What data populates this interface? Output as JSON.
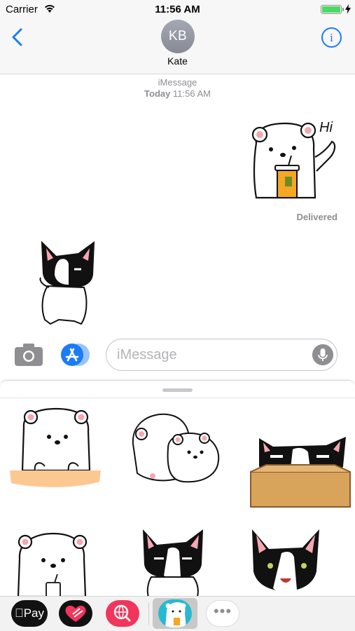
{
  "status_bar": {
    "carrier": "Carrier",
    "time": "11:56 AM"
  },
  "header": {
    "avatar_initials": "KB",
    "contact_name": "Kate"
  },
  "conversation": {
    "service": "iMessage",
    "day": "Today",
    "time": "11:56 AM",
    "sent_sticker_text": "Hi",
    "delivery_status": "Delivered"
  },
  "input": {
    "placeholder": "iMessage"
  },
  "tray": {
    "apple_pay_label": "Pay"
  },
  "colors": {
    "accent": "#1a7cf6",
    "bear_cup": "#f5a623",
    "sticker_app_bg": "#28b9d1",
    "search_app": "#f2355b"
  }
}
